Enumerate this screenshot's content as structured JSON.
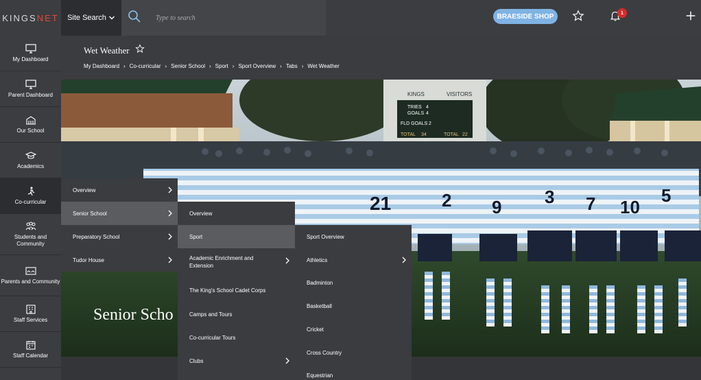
{
  "topbar": {
    "logo_main": "KINGS",
    "logo_accent": "NET",
    "site_search_label": "Site Search",
    "search_placeholder": "Type to search",
    "shop_button": "BRAESIDE SHOP",
    "notification_count": "1"
  },
  "sidebar": {
    "items": [
      {
        "label": "My Dashboard",
        "icon": "monitor-icon"
      },
      {
        "label": "Parent Dashboard",
        "icon": "monitor-icon"
      },
      {
        "label": "Our School",
        "icon": "school-building-icon"
      },
      {
        "label": "Academics",
        "icon": "graduation-cap-icon"
      },
      {
        "label": "Co-curricular",
        "icon": "runner-icon"
      },
      {
        "label": "Students and Community",
        "icon": "people-group-icon"
      },
      {
        "label": "Parents and Community",
        "icon": "parents-icon"
      },
      {
        "label": "Staff Services",
        "icon": "building-icon"
      },
      {
        "label": "Staff Calendar",
        "icon": "calendar-icon"
      }
    ]
  },
  "page": {
    "title": "Wet Weather",
    "breadcrumb": [
      "My Dashboard",
      "Co-curricular",
      "Senior School",
      "Sport",
      "Sport Overview",
      "Tabs",
      "Wet Weather"
    ]
  },
  "hero": {
    "title": "Senior Scho",
    "scoreboard": {
      "home": "KINGS",
      "away": "VISITORS",
      "row1": "TRIES",
      "row2": "GOALS",
      "row3": "FLD GOALS",
      "row4": "TOTAL",
      "v1": "4",
      "v2": "4",
      "v3": "2",
      "v4": "34",
      "total_label": "TOTAL",
      "total_val": "22"
    }
  },
  "menu_level1": [
    {
      "label": "Overview",
      "has_sub": true
    },
    {
      "label": "Senior School",
      "has_sub": true,
      "active": true
    },
    {
      "label": "Preparatory School",
      "has_sub": true
    },
    {
      "label": "Tudor House",
      "has_sub": true
    }
  ],
  "menu_level2": [
    {
      "label": "Overview",
      "has_sub": false
    },
    {
      "label": "Sport",
      "has_sub": false,
      "active": true
    },
    {
      "label": "Academic Enrichment and Extension",
      "has_sub": true
    },
    {
      "label": "The King's School Cadet Corps",
      "has_sub": false
    },
    {
      "label": "Camps and Tours",
      "has_sub": false
    },
    {
      "label": "Co-curricular Tours",
      "has_sub": false
    },
    {
      "label": "Clubs",
      "has_sub": true
    }
  ],
  "menu_level3": [
    {
      "label": "Sport Overview",
      "has_sub": false
    },
    {
      "label": "Athletics",
      "has_sub": true
    },
    {
      "label": "Badminton",
      "has_sub": false
    },
    {
      "label": "Basketball",
      "has_sub": false
    },
    {
      "label": "Cricket",
      "has_sub": false
    },
    {
      "label": "Cross Country",
      "has_sub": false
    },
    {
      "label": "Equestrian",
      "has_sub": false
    }
  ],
  "colors": {
    "topbar": "#3b3d40",
    "accent_button": "#7fb3e3",
    "badge": "#d92b2b",
    "menu_bg": "#3a3c3f",
    "menu_active": "#5a5c5f"
  }
}
